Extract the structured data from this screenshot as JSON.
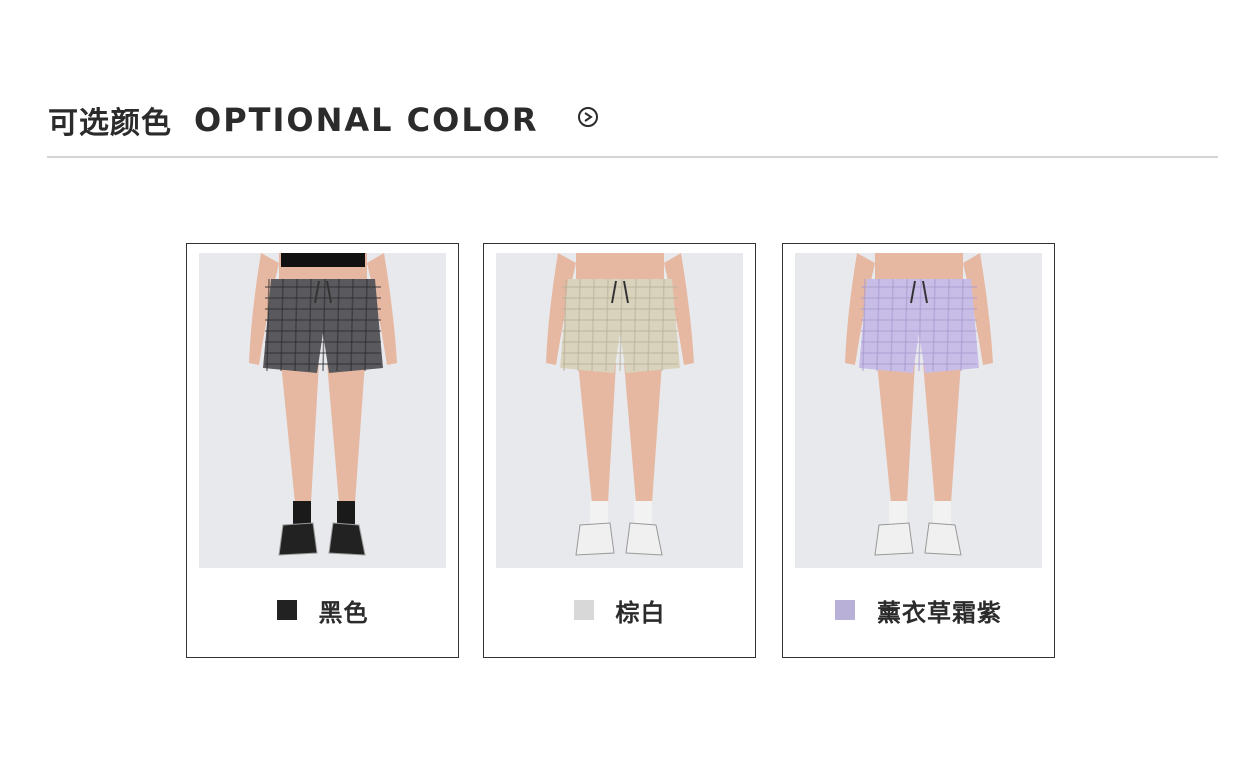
{
  "header": {
    "title_cn": "可选颜色",
    "title_en": "OPTIONAL COLOR",
    "next_icon": "circle-chevron-right-icon"
  },
  "colors": [
    {
      "label": "黑色",
      "swatch": "#222222",
      "fabric": "#5a5a5e",
      "fabric_line": "#2e2e30",
      "sock": "#1a1a1a",
      "shoe": "#222222"
    },
    {
      "label": "棕白",
      "swatch": "#d8d8d8",
      "fabric": "#d9d3bd",
      "fabric_line": "#b9b29a",
      "sock": "#f2f2f2",
      "shoe": "#f0f0f0"
    },
    {
      "label": "薰衣草霜紫",
      "swatch": "#b9b0d8",
      "fabric": "#c8bde6",
      "fabric_line": "#a89bd2",
      "sock": "#f2f2f2",
      "shoe": "#f0f0f0"
    }
  ]
}
